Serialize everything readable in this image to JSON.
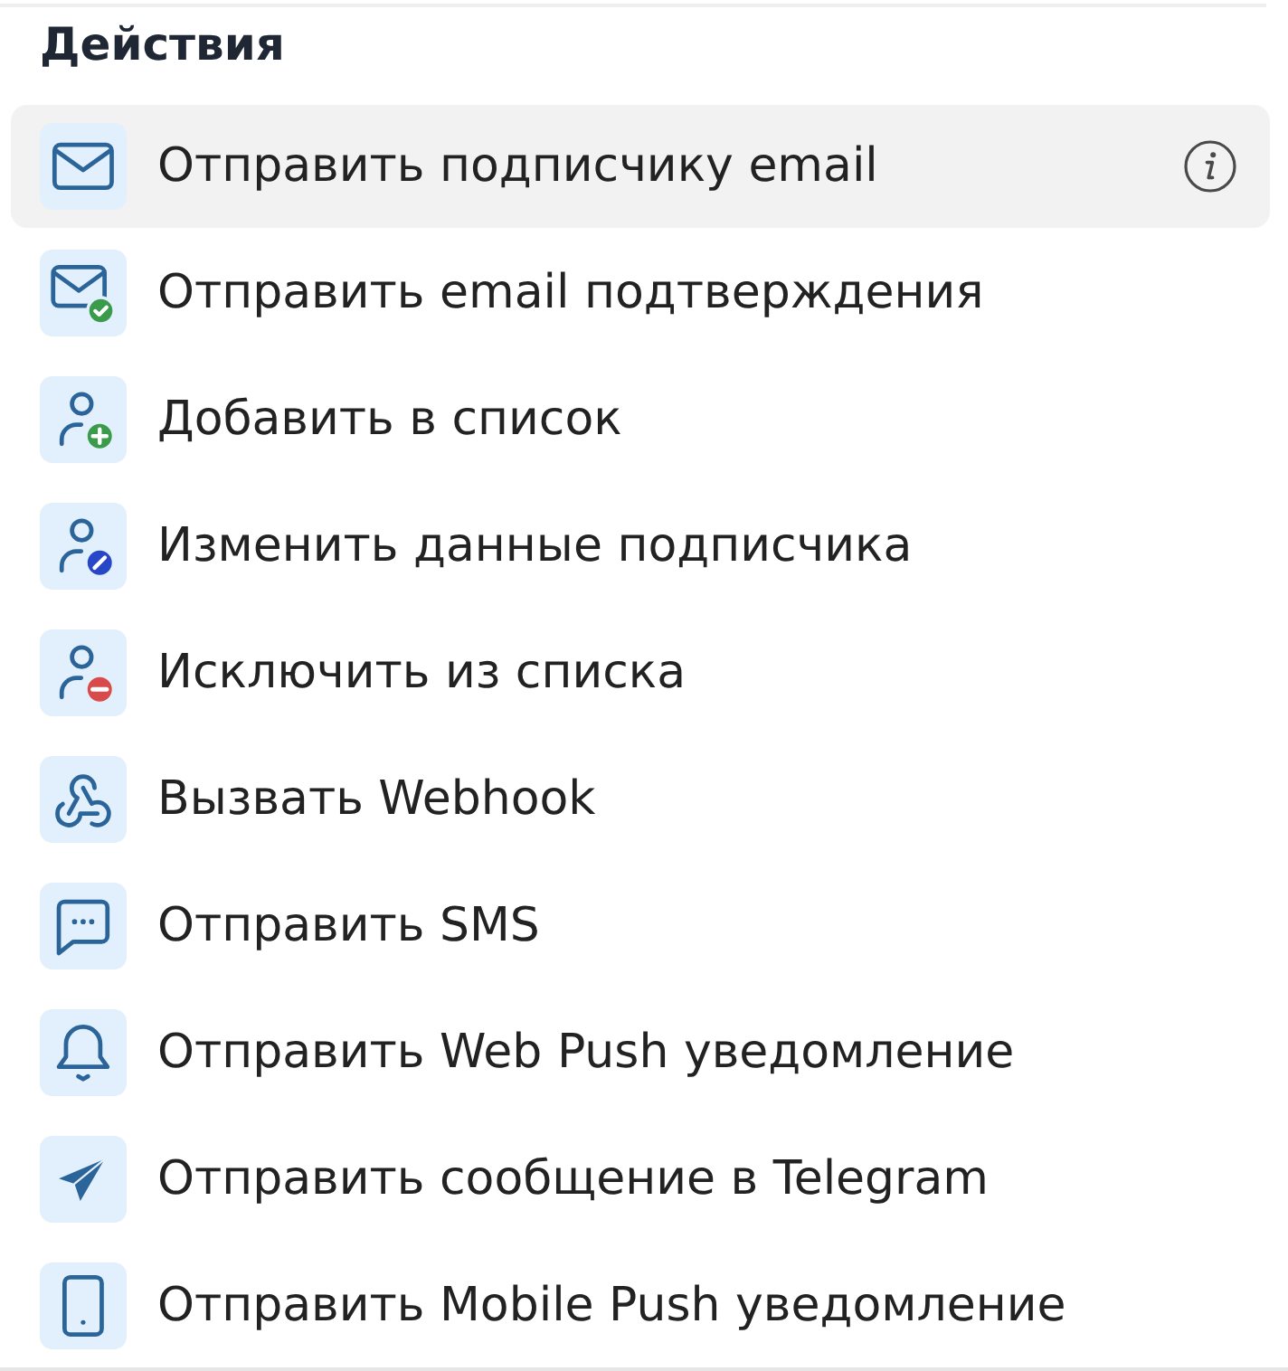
{
  "section": {
    "title": "Действия"
  },
  "actions": [
    {
      "kind": "email",
      "label": "Отправить подписчику email",
      "selected": true,
      "info": true
    },
    {
      "kind": "email-confirm",
      "label": "Отправить email подтверждения",
      "selected": false,
      "info": false
    },
    {
      "kind": "list-add",
      "label": "Добавить в список",
      "selected": false,
      "info": false
    },
    {
      "kind": "subscriber-edit",
      "label": "Изменить данные подписчика",
      "selected": false,
      "info": false
    },
    {
      "kind": "list-remove",
      "label": "Исключить из списка",
      "selected": false,
      "info": false
    },
    {
      "kind": "webhook",
      "label": "Вызвать Webhook",
      "selected": false,
      "info": false
    },
    {
      "kind": "sms",
      "label": "Отправить SMS",
      "selected": false,
      "info": false
    },
    {
      "kind": "web-push",
      "label": "Отправить Web Push уведомление",
      "selected": false,
      "info": false
    },
    {
      "kind": "telegram",
      "label": "Отправить сообщение в Telegram",
      "selected": false,
      "info": false
    },
    {
      "kind": "mobile-push",
      "label": "Отправить Mobile Push уведомление",
      "selected": false,
      "info": false
    }
  ]
}
